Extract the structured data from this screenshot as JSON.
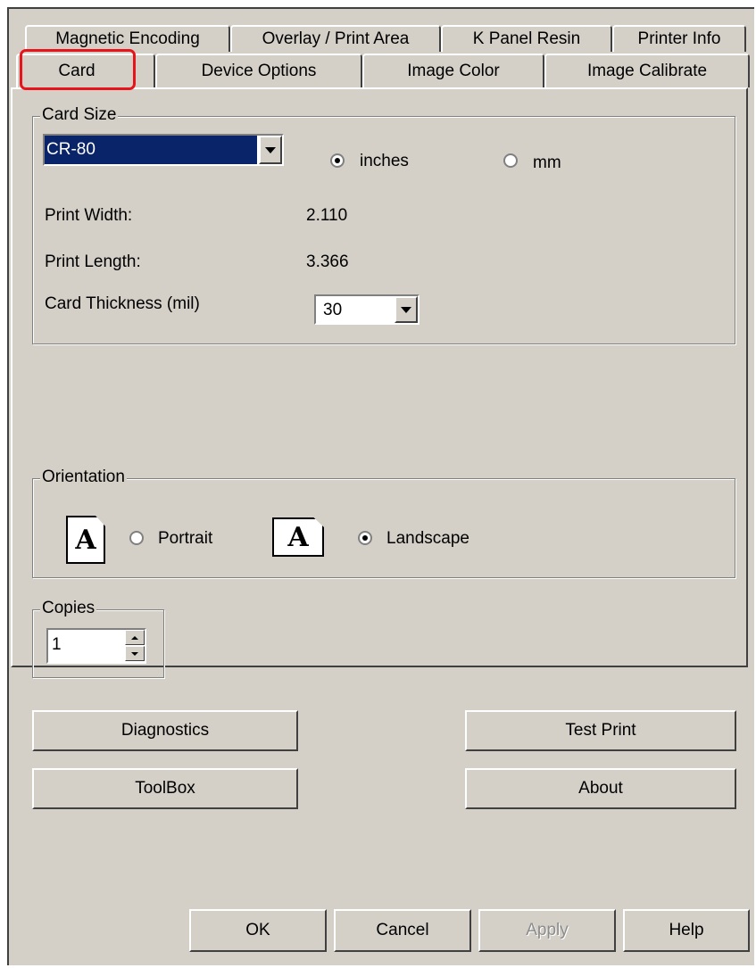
{
  "tabs": {
    "row1": [
      "Magnetic Encoding",
      "Overlay / Print Area",
      "K Panel Resin",
      "Printer Info"
    ],
    "row2": [
      "Card",
      "Device Options",
      "Image Color",
      "Image Calibrate"
    ]
  },
  "card_size": {
    "label": "Card Size",
    "selected": "CR-80",
    "unit_inches": "inches",
    "unit_mm": "mm",
    "selected_unit": "inches",
    "print_width_label": "Print Width:",
    "print_width_value": "2.110",
    "print_length_label": "Print Length:",
    "print_length_value": "3.366",
    "thickness_label": "Card Thickness (mil)",
    "thickness_value": "30"
  },
  "orientation": {
    "label": "Orientation",
    "portrait": "Portrait",
    "landscape": "Landscape",
    "selected": "Landscape",
    "icon_letter": "A"
  },
  "copies": {
    "label": "Copies",
    "value": "1"
  },
  "buttons": {
    "diagnostics": "Diagnostics",
    "test_print": "Test Print",
    "toolbox": "ToolBox",
    "about": "About"
  },
  "footer": {
    "ok": "OK",
    "cancel": "Cancel",
    "apply": "Apply",
    "help": "Help"
  },
  "colors": {
    "highlight": "#e8141c",
    "selection": "#0a246a",
    "face": "#d4d0c8"
  }
}
